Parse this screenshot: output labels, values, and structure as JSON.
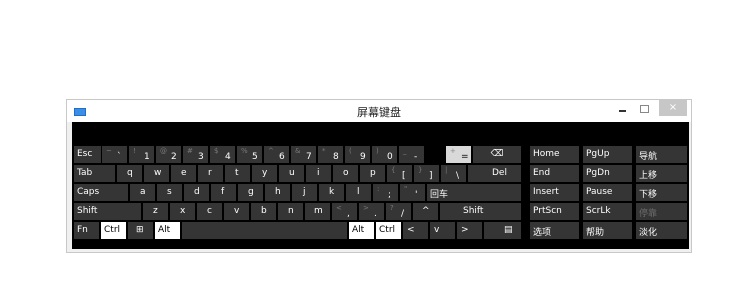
{
  "window": {
    "title": "屏幕键盘",
    "minimize_icon": "minimize-icon",
    "maximize_icon": "maximize-icon",
    "close_icon": "close-icon",
    "close_glyph": "×"
  },
  "rows": {
    "row1": {
      "esc": "Esc",
      "backtick": {
        "shift": "~",
        "main": "`"
      },
      "k1": {
        "shift": "!",
        "main": "1"
      },
      "k2": {
        "shift": "@",
        "main": "2"
      },
      "k3": {
        "shift": "#",
        "main": "3"
      },
      "k4": {
        "shift": "$",
        "main": "4"
      },
      "k5": {
        "shift": "%",
        "main": "5"
      },
      "k6": {
        "shift": "^",
        "main": "6"
      },
      "k7": {
        "shift": "&",
        "main": "7"
      },
      "k8": {
        "shift": "*",
        "main": "8"
      },
      "k9": {
        "shift": "(",
        "main": "9"
      },
      "k0": {
        "shift": ")",
        "main": "0"
      },
      "minus": {
        "shift": "_",
        "main": "-"
      },
      "equals": {
        "shift": "+",
        "main": "="
      },
      "backspace": "⌫"
    },
    "row2": {
      "tab": "Tab",
      "q": "q",
      "w": "w",
      "e": "e",
      "r": "r",
      "t": "t",
      "y": "y",
      "u": "u",
      "i": "i",
      "o": "o",
      "p": "p",
      "lbracket": {
        "shift": "{",
        "main": "["
      },
      "rbracket": {
        "shift": "}",
        "main": "]"
      },
      "backslash": {
        "shift": "|",
        "main": "\\"
      },
      "del": "Del"
    },
    "row3": {
      "caps": "Caps",
      "a": "a",
      "s": "s",
      "d": "d",
      "f": "f",
      "g": "g",
      "h": "h",
      "j": "j",
      "k": "k",
      "l": "l",
      "semicolon": {
        "shift": ":",
        "main": ";"
      },
      "quote": {
        "shift": "\"",
        "main": "'"
      },
      "enter": "回车"
    },
    "row4": {
      "shift_left": "Shift",
      "z": "z",
      "x": "x",
      "c": "c",
      "v": "v",
      "b": "b",
      "n": "n",
      "m": "m",
      "comma": {
        "shift": "<",
        "main": ","
      },
      "period": {
        "shift": ">",
        "main": "."
      },
      "slash": {
        "shift": "?",
        "main": "/"
      },
      "up": "^",
      "shift_right": "Shift"
    },
    "row5": {
      "fn": "Fn",
      "ctrl_left": "Ctrl",
      "win": "⊞",
      "alt_left": "Alt",
      "alt_right": "Alt",
      "ctrl_right": "Ctrl",
      "left": "<",
      "down": "v",
      "right": ">",
      "menu": "▤"
    }
  },
  "nav": {
    "home": "Home",
    "pgup": "PgUp",
    "nav": "导航",
    "end": "End",
    "pgdn": "PgDn",
    "moveup": "上移",
    "insert": "Insert",
    "pause": "Pause",
    "movedown": "下移",
    "prtscn": "PrtScn",
    "scrlk": "ScrLk",
    "dock": "停靠",
    "options": "选项",
    "help": "帮助",
    "fade": "淡化"
  },
  "colors": {
    "key": "#353535",
    "panel": "#000000",
    "highlight": "#d9d9d9",
    "white_key": "#ffffff"
  }
}
